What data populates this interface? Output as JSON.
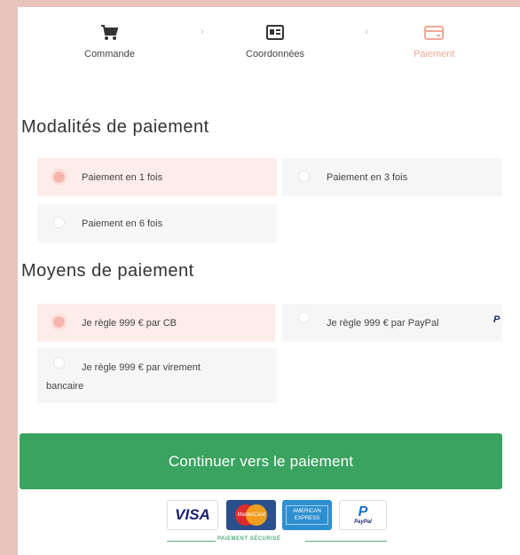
{
  "steps": [
    {
      "label": "Commande",
      "icon": "cart-icon"
    },
    {
      "label": "Coordonnées",
      "icon": "id-card-icon"
    },
    {
      "label": "Paiement",
      "icon": "credit-card-icon",
      "active": true
    }
  ],
  "modalites": {
    "title": "Modalités de paiement",
    "options": [
      {
        "label": "Paiement en 1 fois",
        "selected": true
      },
      {
        "label": "Paiement en 3 fois",
        "selected": false
      },
      {
        "label": "Paiement en 6 fois",
        "selected": false
      }
    ]
  },
  "moyens": {
    "title": "Moyens de paiement",
    "options": [
      {
        "label": "Je règle 999 € par CB",
        "selected": true
      },
      {
        "label": "Je règle 999 € par PayPal",
        "selected": false,
        "icon": "paypal-icon"
      },
      {
        "label_line1": "Je règle 999 € par virement",
        "label_line2": "bancaire",
        "selected": false
      }
    ]
  },
  "cta": {
    "label": "Continuer vers le paiement"
  },
  "cards": {
    "visa": "VISA",
    "mastercard": "MasterCard",
    "amex": "AMERICAN EXPRESS",
    "paypal": "PayPal"
  },
  "secure_label": "PAIEMENT SÉCURISÉ",
  "colors": {
    "accent": "#3aa35f",
    "selected_bg": "#fcecea",
    "radio_selected": "#f6b4ab",
    "page_bg": "#e8c4bc",
    "active_step": "#f0a898"
  }
}
